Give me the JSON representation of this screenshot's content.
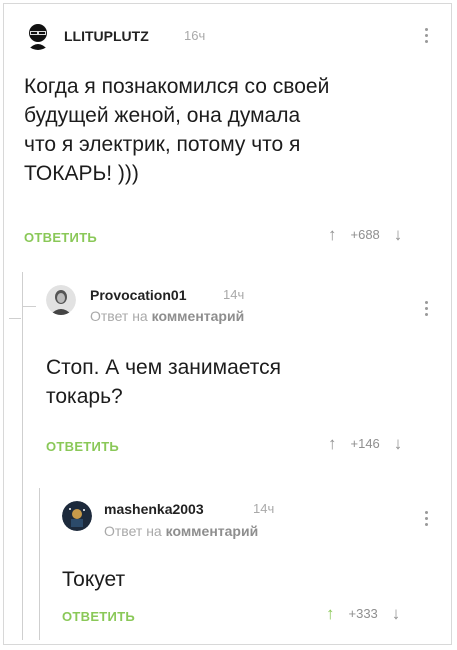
{
  "comments": [
    {
      "username": "LLITUPLUTZ",
      "time": "16ч",
      "text_lines": [
        "Когда я познакомился со своей",
        "будущей женой, она думала",
        "что я электрик, потому что я",
        "ТОКАРЬ! )))"
      ],
      "reply_label": "ОТВЕТИТЬ",
      "score": "+688",
      "up_arrow": "↑",
      "down_arrow": "↓"
    },
    {
      "username": "Provocation01",
      "time": "14ч",
      "reply_to_prefix": "Ответ на",
      "reply_to_link": "комментарий",
      "text_lines": [
        "Стоп. А чем занимается",
        "токарь?"
      ],
      "reply_label": "ОТВЕТИТЬ",
      "score": "+146",
      "up_arrow": "↑",
      "down_arrow": "↓"
    },
    {
      "username": "mashenka2003",
      "time": "14ч",
      "reply_to_prefix": "Ответ на",
      "reply_to_link": "комментарий",
      "text_lines": [
        "Токует"
      ],
      "reply_label": "ОТВЕТИТЬ",
      "score": "+333",
      "up_arrow": "↑",
      "down_arrow": "↓"
    }
  ],
  "colors": {
    "accent_green": "#8ac858",
    "muted": "#a9a9a9",
    "thread_line": "#cfcfcf"
  },
  "icons": {
    "menu": "kebab-menu-icon",
    "collapse": "collapse-thread-icon"
  }
}
